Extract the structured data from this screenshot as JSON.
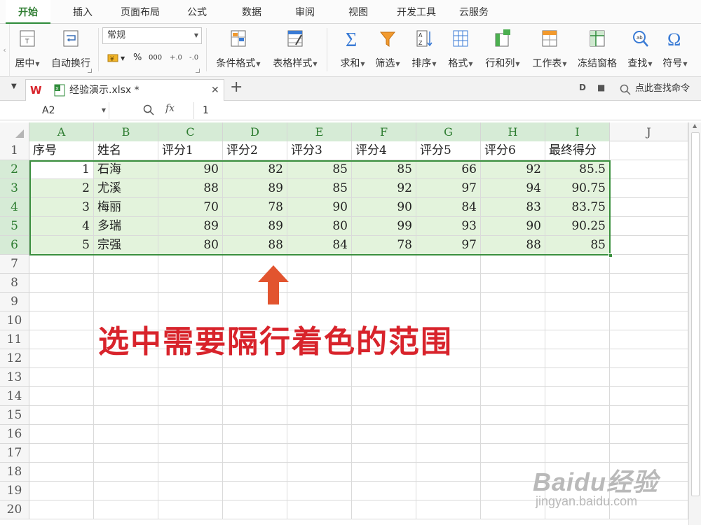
{
  "menu": {
    "tabs": [
      "开始",
      "插入",
      "页面布局",
      "公式",
      "数据",
      "审阅",
      "视图",
      "开发工具",
      "云服务"
    ],
    "active_tab": "开始"
  },
  "ribbon": {
    "merge_center": "居中",
    "wrap_text": "自动换行",
    "number_format": "常规",
    "percent": "%",
    "comma": "000",
    "dec_inc": "+.0",
    "dec_dec": "-.0",
    "cond_format": "条件格式",
    "table_style": "表格样式",
    "sum": "求和",
    "filter": "筛选",
    "sort": "排序",
    "format": "格式",
    "row_col": "行和列",
    "worksheet": "工作表",
    "freeze": "冻结窗格",
    "find": "查找",
    "symbol": "符号"
  },
  "tabbar": {
    "file_name": "经验演示.xlsx *",
    "find_command": "点此查找命令"
  },
  "formula_bar": {
    "name_box": "A2",
    "fx": "fx",
    "value": "1"
  },
  "sheet": {
    "columns": [
      "A",
      "B",
      "C",
      "D",
      "E",
      "F",
      "G",
      "H",
      "I",
      "J"
    ],
    "row_numbers": [
      "1",
      "2",
      "3",
      "4",
      "5",
      "6",
      "7",
      "8",
      "9",
      "10",
      "11",
      "12",
      "13",
      "14",
      "15",
      "16",
      "17",
      "18",
      "19",
      "20"
    ],
    "header": [
      "序号",
      "姓名",
      "评分1",
      "评分2",
      "评分3",
      "评分4",
      "评分5",
      "评分6",
      "最终得分"
    ],
    "rows": [
      [
        "1",
        "石海",
        "90",
        "82",
        "85",
        "85",
        "66",
        "92",
        "85.5"
      ],
      [
        "2",
        "尤溪",
        "88",
        "89",
        "85",
        "92",
        "97",
        "94",
        "90.75"
      ],
      [
        "3",
        "梅丽",
        "70",
        "78",
        "90",
        "90",
        "84",
        "83",
        "83.75"
      ],
      [
        "4",
        "多瑞",
        "89",
        "89",
        "80",
        "99",
        "93",
        "90",
        "90.25"
      ],
      [
        "5",
        "宗强",
        "80",
        "88",
        "84",
        "78",
        "97",
        "88",
        "85"
      ]
    ]
  },
  "annotation": {
    "text": "选中需要隔行着色的范围",
    "color": "#d8232b",
    "arrow_color": "#e2542f"
  },
  "watermark": {
    "logo": "Baidu经验",
    "url": "jingyan.baidu.com"
  },
  "colors": {
    "accent": "#2e8b3a",
    "selection_fill": "#e3f3dc",
    "header_selected": "#d6ebd6"
  }
}
